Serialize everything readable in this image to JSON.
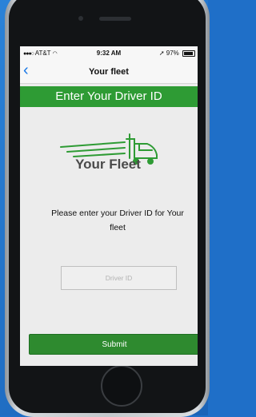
{
  "status_bar": {
    "carrier": "AT&T",
    "time": "9:32 AM",
    "battery": "97%"
  },
  "nav": {
    "back_icon": "chevron-left-icon",
    "title": "Your fleet"
  },
  "banner": {
    "title": "Enter Your Driver ID"
  },
  "logo": {
    "text": "Your Fleet",
    "icon": "truck-icon"
  },
  "prompt": {
    "text": "Please enter your Driver ID for Your fleet"
  },
  "driver_id_input": {
    "value": "",
    "placeholder": "Driver ID"
  },
  "submit": {
    "label": "Submit"
  },
  "colors": {
    "brand_green": "#2e9b34",
    "button_green": "#2e8a2f",
    "link_blue": "#1877e6",
    "background_blue": "#1f6fc8"
  }
}
